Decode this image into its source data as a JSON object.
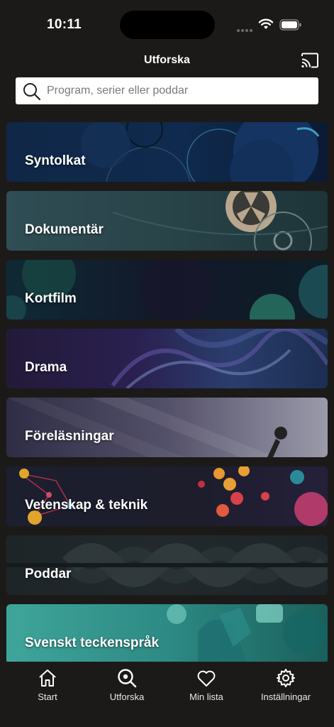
{
  "status_bar": {
    "time": "10:11"
  },
  "header": {
    "title": "Utforska"
  },
  "search": {
    "placeholder": "Program, serier eller poddar"
  },
  "categories": [
    {
      "label": "Syntolkat"
    },
    {
      "label": "Dokumentär"
    },
    {
      "label": "Kortfilm"
    },
    {
      "label": "Drama"
    },
    {
      "label": "Föreläsningar"
    },
    {
      "label": "Vetenskap & teknik"
    },
    {
      "label": "Poddar"
    },
    {
      "label": "Svenskt teckenspråk"
    }
  ],
  "tab_bar": {
    "items": [
      {
        "label": "Start",
        "icon": "home-icon"
      },
      {
        "label": "Utforska",
        "icon": "explore-search-icon"
      },
      {
        "label": "Min lista",
        "icon": "heart-icon"
      },
      {
        "label": "Inställningar",
        "icon": "gear-icon"
      }
    ]
  }
}
